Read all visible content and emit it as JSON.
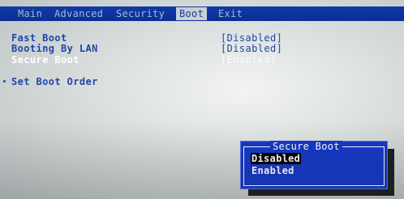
{
  "tabs": [
    {
      "label": "Main",
      "active": false
    },
    {
      "label": "Advanced",
      "active": false
    },
    {
      "label": "Security",
      "active": false
    },
    {
      "label": "Boot",
      "active": true
    },
    {
      "label": "Exit",
      "active": false
    }
  ],
  "settings": [
    {
      "label": "Fast Boot",
      "value": "[Disabled]",
      "selected": false
    },
    {
      "label": "Booting By LAN",
      "value": "[Disabled]",
      "selected": false
    },
    {
      "label": "Secure Boot",
      "value": "[Enabled]",
      "selected": true
    }
  ],
  "submenu": {
    "label": "Set Boot Order",
    "arrow": "▸"
  },
  "popup": {
    "title": "Secure Boot",
    "options": [
      {
        "label": "Disabled",
        "highlighted": true
      },
      {
        "label": "Enabled",
        "highlighted": false
      }
    ]
  },
  "colors": {
    "menubar": "#0f3aa6",
    "text": "#1f47a7",
    "popup_bg": "#1438c8",
    "highlight": "#000000"
  }
}
